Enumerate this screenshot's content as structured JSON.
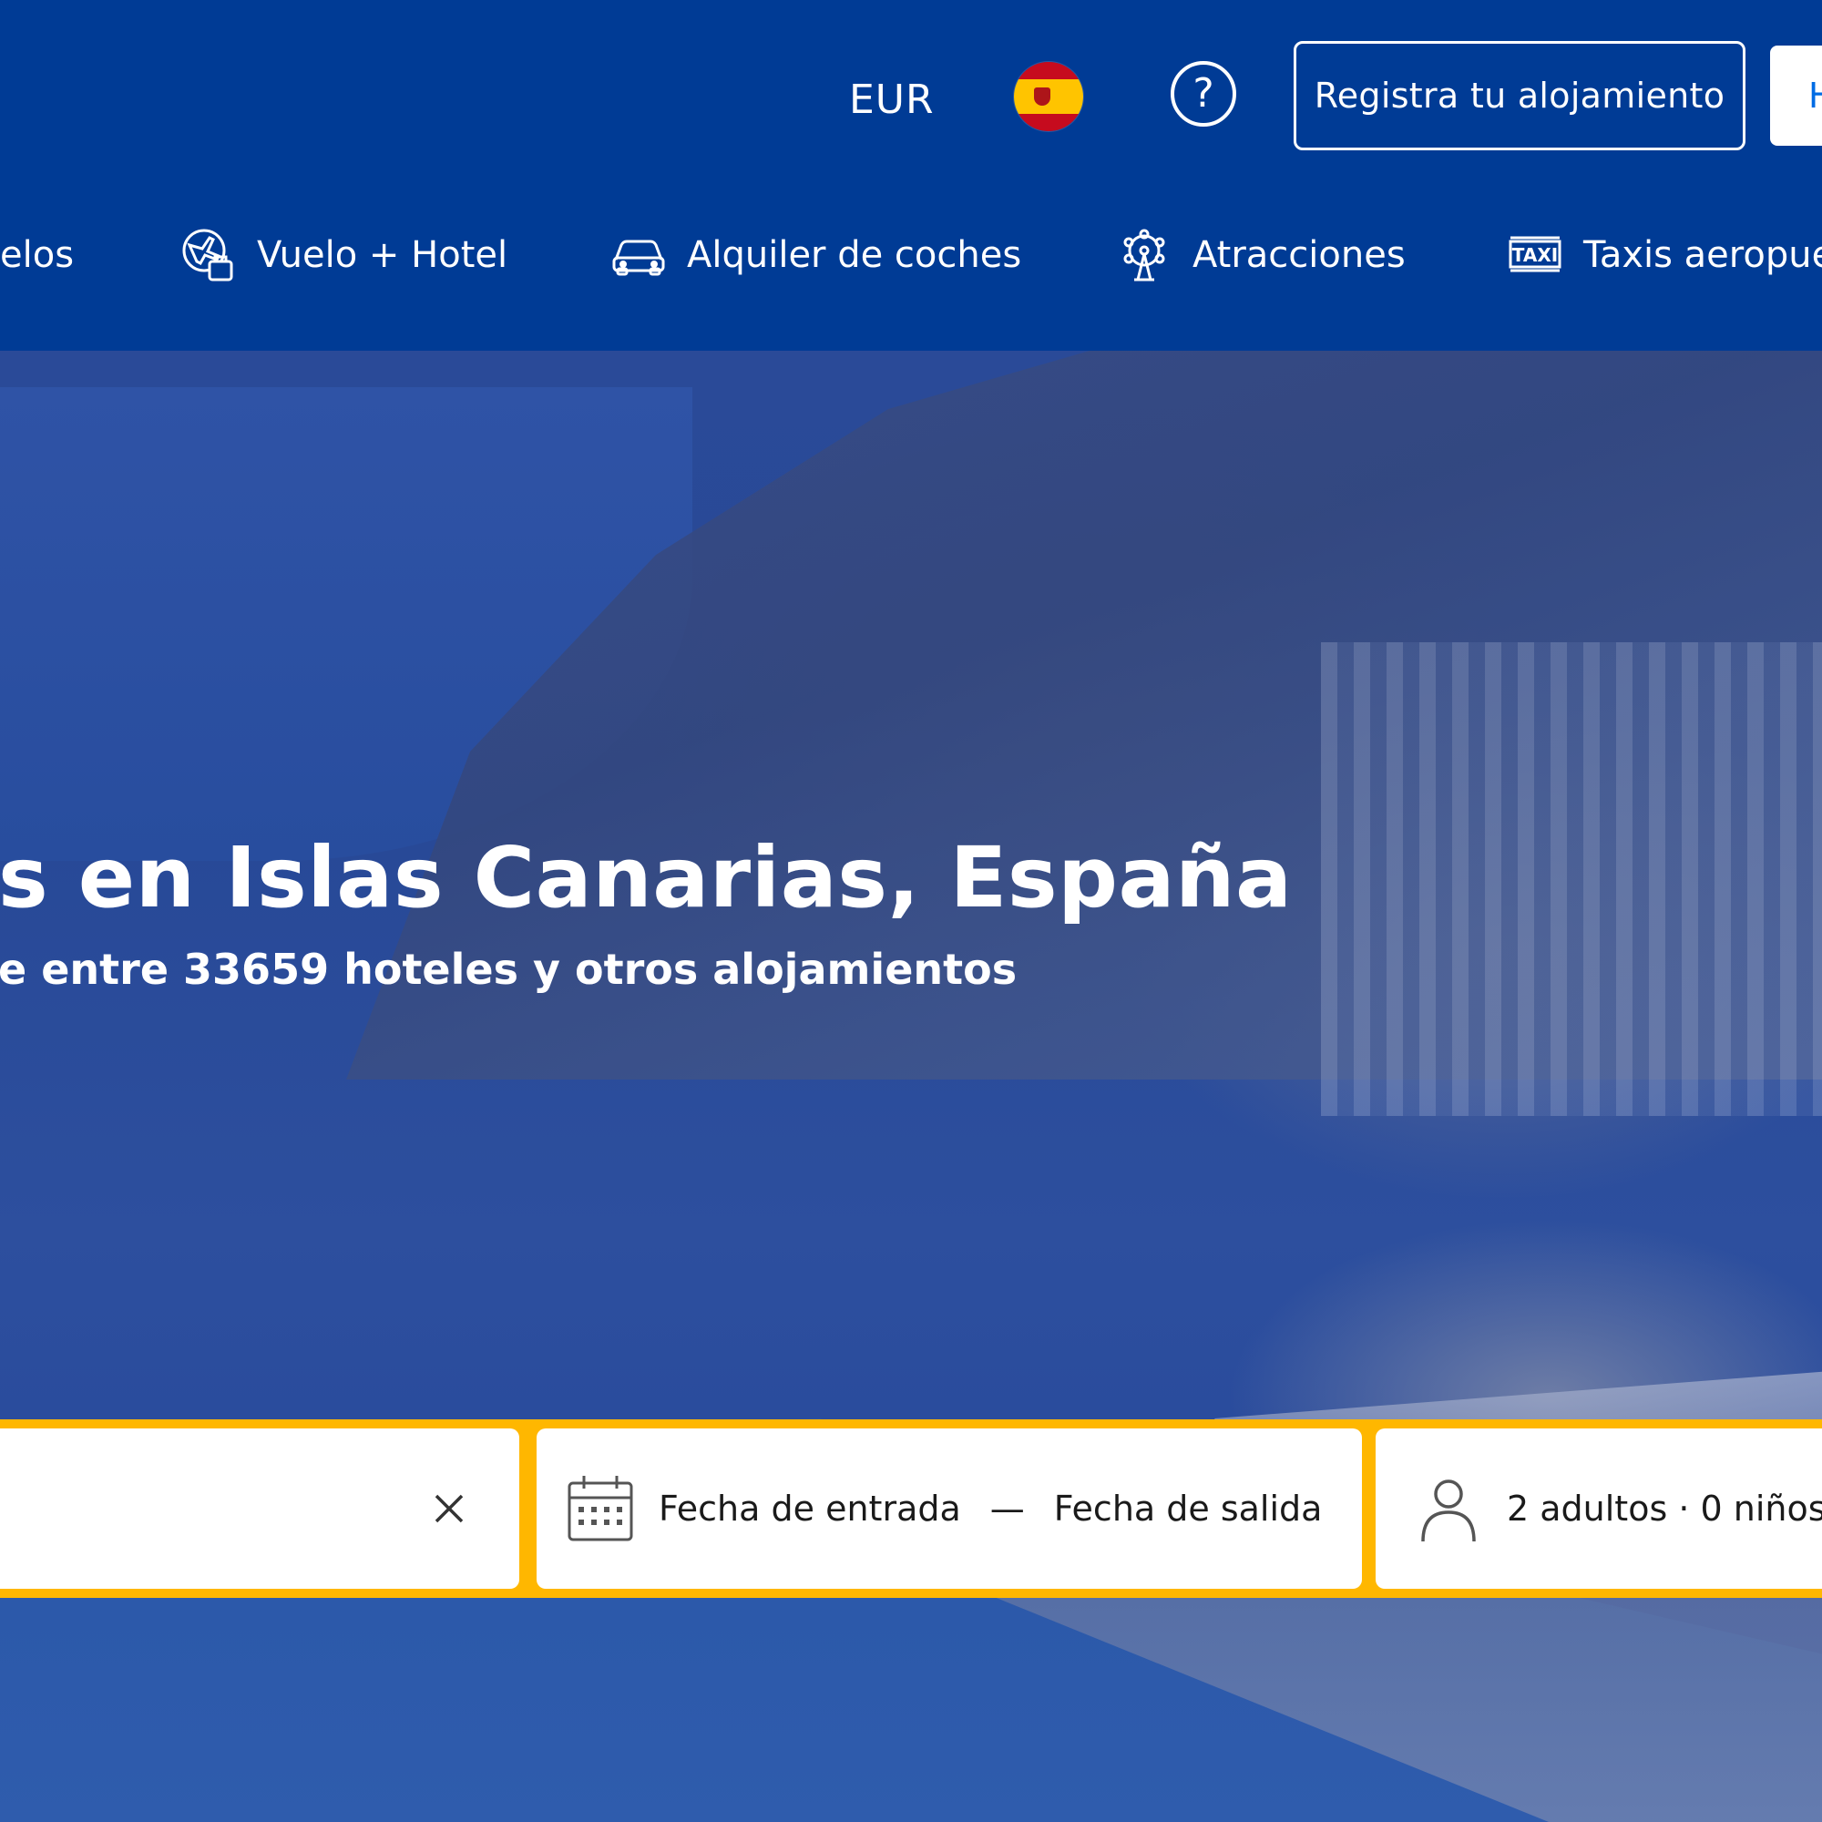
{
  "header": {
    "currency": "EUR",
    "register_label": "Registra tu alojamiento",
    "signin_label": "H"
  },
  "nav": {
    "items": [
      {
        "label": "elos",
        "icon": "plane-icon"
      },
      {
        "label": "Vuelo + Hotel",
        "icon": "flight-hotel-icon"
      },
      {
        "label": "Alquiler de coches",
        "icon": "car-icon"
      },
      {
        "label": "Atracciones",
        "icon": "ferris-wheel-icon"
      },
      {
        "label": "Taxis aeropue",
        "icon": "taxi-icon"
      }
    ]
  },
  "hero": {
    "title": "s en Islas Canarias, España",
    "subtitle": "e entre 33659 hoteles y otros alojamientos"
  },
  "search": {
    "checkin_label": "Fecha de entrada",
    "date_separator": "—",
    "checkout_label": "Fecha de salida",
    "guests_label": "2 adultos · 0 niños"
  },
  "colors": {
    "brand_blue": "#003b95",
    "search_border": "#ffb700"
  }
}
